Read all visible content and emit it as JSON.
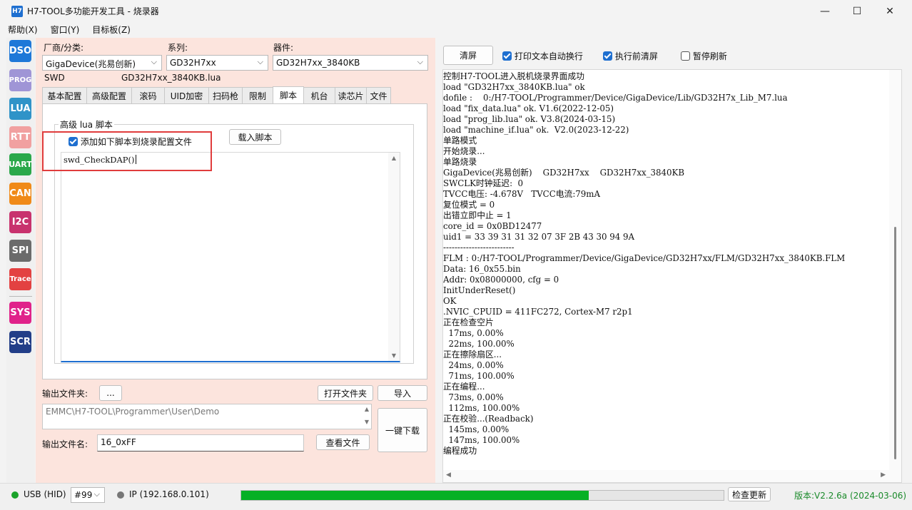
{
  "window": {
    "icon_text": "H7",
    "title": "H7-TOOL多功能开发工具 - 烧录器",
    "minimize": "—",
    "maximize": "☐",
    "close": "✕"
  },
  "menu": [
    "帮助(X)",
    "窗口(Y)",
    "目标板(Z)"
  ],
  "sidebar": [
    {
      "label": "DSO",
      "color": "#1e78d8"
    },
    {
      "label": "PROG",
      "color": "#9f95d6"
    },
    {
      "label": "LUA",
      "color": "#2f93c8"
    },
    {
      "label": "RTT",
      "color": "#f1a0a0"
    },
    {
      "label": "UART",
      "color": "#2aa84a"
    },
    {
      "label": "CAN",
      "color": "#f08a18"
    },
    {
      "label": "I2C",
      "color": "#c8326e"
    },
    {
      "label": "SPI",
      "color": "#6b6b6b"
    },
    {
      "label": "Trace",
      "color": "#e34141"
    },
    {
      "label": "SYS",
      "color": "#e0228a"
    },
    {
      "label": "SCR",
      "color": "#223e88"
    }
  ],
  "selectors": {
    "vendor_label": "厂商/分类:",
    "vendor_value": "GigaDevice(兆易创新)",
    "series_label": "系列:",
    "series_value": "GD32H7xx",
    "device_label": "器件:",
    "device_value": "GD32H7xx_3840KB",
    "interface": "SWD",
    "lua_file": "GD32H7xx_3840KB.lua"
  },
  "tabs": [
    "基本配置",
    "高级配置",
    "滚码",
    "UID加密",
    "扫码枪",
    "限制",
    "脚本",
    "机台",
    "读芯片",
    "文件"
  ],
  "active_tab": "脚本",
  "script_tab": {
    "group_title": "高级 lua 脚本",
    "checkbox_label": "添加如下脚本到烧录配置文件",
    "load_button": "载入脚本",
    "script_text": "swd_CheckDAP()"
  },
  "output": {
    "folder_label": "输出文件夹:",
    "browse_button": "...",
    "open_folder_button": "打开文件夹",
    "import_button": "导入",
    "folder_path": "EMMC\\H7-TOOL\\Programmer\\User\\Demo",
    "one_key_button": "一键下载",
    "filename_label": "输出文件名:",
    "filename_value": "16_0xFF",
    "view_file_button": "查看文件"
  },
  "log_toolbar": {
    "clear_button": "清屏",
    "auto_wrap_label": "打印文本自动换行",
    "auto_wrap_checked": true,
    "clear_before_label": "执行前清屏",
    "clear_before_checked": true,
    "pause_label": "暂停刷新",
    "pause_checked": false
  },
  "log_lines": [
    "控制H7-TOOL进入脱机烧录界面成功",
    "load \"GD32H7xx_3840KB.lua\" ok",
    "dofile :    0:/H7-TOOL/Programmer/Device/GigaDevice/Lib/GD32H7x_Lib_M7.lua",
    "load \"fix_data.lua\" ok. V1.6(2022-12-05)",
    "load \"prog_lib.lua\" ok. V3.8(2024-03-15)",
    "load \"machine_if.lua\" ok.  V2.0(2023-12-22)",
    "单路模式",
    "开始烧录...",
    "单路烧录",
    "GigaDevice(兆易创新)    GD32H7xx    GD32H7xx_3840KB",
    "SWCLK时钟延迟:  0",
    "TVCC电压: -4.678V   TVCC电流:79mA",
    "复位模式 = 0",
    "出错立即中止 = 1",
    "core_id = 0x0BD12477",
    "uid1 = 33 39 31 31 32 07 3F 2B 43 30 94 9A",
    "-------------------------",
    "FLM : 0:/H7-TOOL/Programmer/Device/GigaDevice/GD32H7xx/FLM/GD32H7xx_3840KB.FLM",
    "Data: 16_0x55.bin",
    "Addr: 0x08000000, cfg = 0",
    "InitUnderReset()",
    "OK",
    ".NVIC_CPUID = 411FC272, Cortex-M7 r2p1",
    "正在检查空片",
    "  17ms, 0.00%",
    "  22ms, 100.00%",
    "正在擦除扇区...",
    "  24ms, 0.00%",
    "  71ms, 100.00%",
    "正在编程...",
    "  73ms, 0.00%",
    "  112ms, 100.00%",
    "正在校验...(Readback)",
    "  145ms, 0.00%",
    "  147ms, 100.00%",
    "编程成功"
  ],
  "status": {
    "usb_label": "USB (HID)",
    "usb_color": "#1aa32a",
    "device_number": "#99",
    "ip_label": "IP (192.168.0.101)",
    "ip_color": "#777777",
    "progress": 0.72,
    "progress_color": "#06b025",
    "check_update_button": "检查更新",
    "version": "版本:V2.2.6a (2024-03-06)",
    "version_color": "#1a8a2a"
  }
}
